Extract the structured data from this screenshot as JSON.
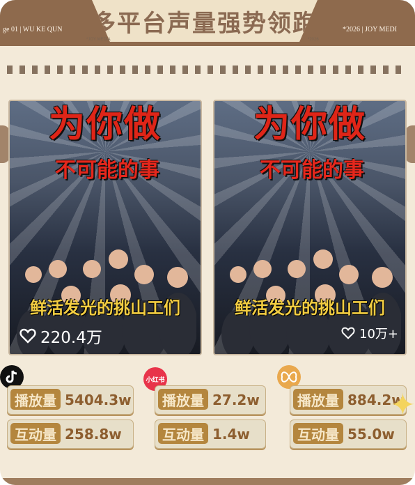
{
  "header": {
    "title": "多平台声量强势领跑",
    "side_left": "ge 01 | WU KE QUN",
    "side_right": "*2026 | JOY MEDI",
    "tiny_left": "*JOY MEDIA",
    "tiny_right": "*2026"
  },
  "posters": [
    {
      "main": "为你做",
      "sub": "不可能的事",
      "caption": "鲜活发光的挑山工们",
      "likes": "220.4万"
    },
    {
      "main": "为你做",
      "sub": "不可能的事",
      "caption": "鲜活发光的挑山工们",
      "likes": "10万+"
    }
  ],
  "platforms": [
    {
      "icon": "tiktok-icon",
      "play_label": "播放量",
      "play_value": "5404.3w",
      "interact_label": "互动量",
      "interact_value": "258.8w"
    },
    {
      "icon": "xiaohongshu-icon",
      "icon_text": "小红书",
      "play_label": "播放量",
      "play_value": "27.2w",
      "interact_label": "互动量",
      "interact_value": "1.4w"
    },
    {
      "icon": "butterfly-icon",
      "play_label": "播放量",
      "play_value": "884.2w",
      "interact_label": "互动量",
      "interact_value": "55.0w"
    }
  ],
  "colors": {
    "background": "#f3ead9",
    "band": "#8e6a4d",
    "accent_gold": "#b4863e",
    "value_brown": "#8d5e2f",
    "poster_red": "#df2518",
    "caption_yellow": "#f2cd42"
  }
}
